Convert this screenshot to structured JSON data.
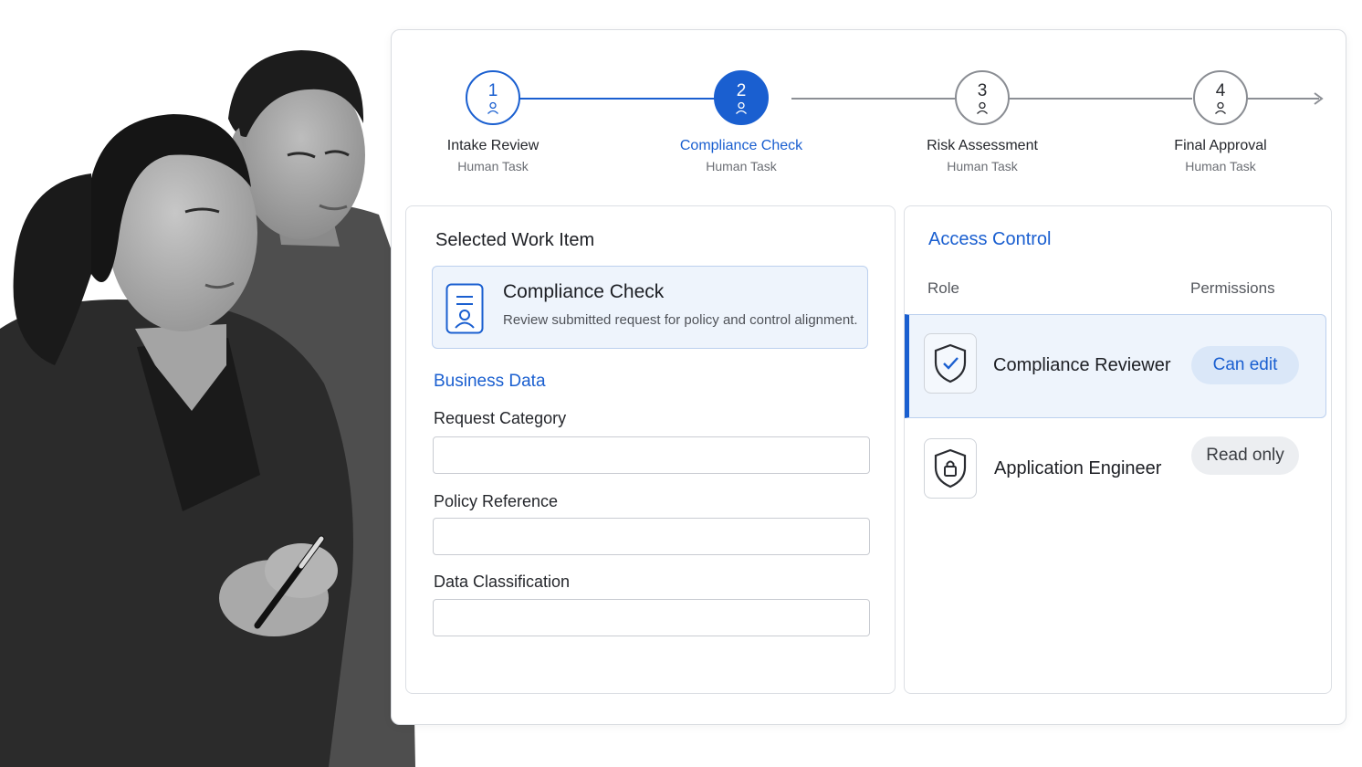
{
  "stepper": {
    "steps": [
      {
        "number": "1",
        "title": "Intake Review",
        "subtitle": "Human Task",
        "state": "done"
      },
      {
        "number": "2",
        "title": "Compliance Check",
        "subtitle": "Human Task",
        "state": "active"
      },
      {
        "number": "3",
        "title": "Risk Assessment",
        "subtitle": "Human Task",
        "state": "pending"
      },
      {
        "number": "4",
        "title": "Final Approval",
        "subtitle": "Human Task",
        "state": "pending"
      }
    ]
  },
  "work_item": {
    "heading": "Selected Work Item",
    "title": "Compliance Check",
    "description": "Review submitted request for policy and control alignment.",
    "icon": "document-user-icon"
  },
  "business_data": {
    "heading": "Business Data",
    "fields": [
      {
        "label": "Request Category",
        "value": ""
      },
      {
        "label": "Policy Reference",
        "value": ""
      },
      {
        "label": "Data Classification",
        "value": ""
      }
    ]
  },
  "access_control": {
    "heading": "Access Control",
    "role_header": "Role",
    "permissions_header": "Permissions",
    "roles": [
      {
        "name": "Compliance Reviewer",
        "permission": "Can edit",
        "icon": "shield-check-icon",
        "selected": true
      },
      {
        "name": "Application Engineer",
        "permission": "Read only",
        "icon": "shield-lock-icon",
        "selected": false
      }
    ]
  },
  "colors": {
    "accent": "#1a5fd0",
    "selected_bg": "#eef4fc",
    "edit_badge_bg": "#dae7f8",
    "read_badge_bg": "#eceef1"
  }
}
